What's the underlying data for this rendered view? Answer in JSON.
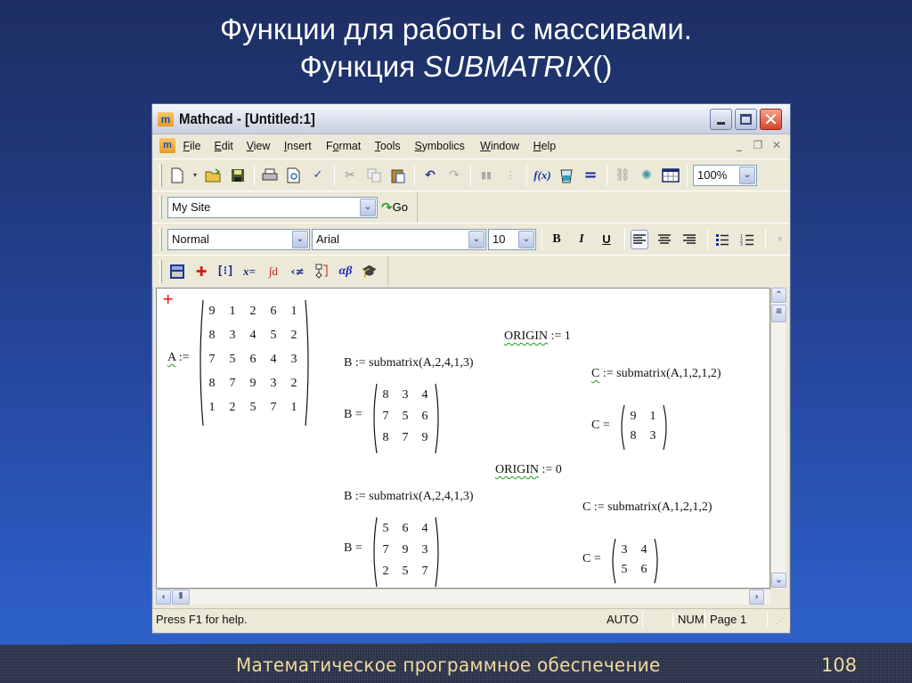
{
  "slide": {
    "title_line1": "Функции для работы с массивами.",
    "title_line2_prefix": "Функция ",
    "title_line2_func": "SUBMATRIX",
    "title_line2_suffix": "()",
    "footer_text": "Математическое программное обеспечение",
    "page_number": "108"
  },
  "window": {
    "title": "Mathcad - [Untitled:1]",
    "app_icon": "mathcad-icon",
    "controls": {
      "minimize": "minimize-icon",
      "maximize": "maximize-icon",
      "close": "close-icon"
    },
    "menu": [
      "File",
      "Edit",
      "View",
      "Insert",
      "Format",
      "Tools",
      "Symbolics",
      "Window",
      "Help"
    ],
    "menu_mnemonics": [
      "F",
      "E",
      "V",
      "I",
      "o",
      "T",
      "S",
      "W",
      "H"
    ],
    "mdi_controls": [
      "_",
      "❐",
      "✕"
    ]
  },
  "standard_toolbar": {
    "icons": [
      "new-document-icon",
      "dropdown-arrow-icon",
      "open-folder-icon",
      "save-icon",
      "print-icon",
      "print-preview-icon",
      "spellcheck-icon",
      "cut-icon",
      "copy-icon",
      "paste-icon",
      "undo-icon",
      "redo-icon",
      "align-across-icon",
      "align-down-icon",
      "insert-function-icon",
      "insert-unit-icon",
      "calculate-icon",
      "insert-hyperlink-icon",
      "component-wizard-icon",
      "resources-icon"
    ],
    "zoom_value": "100%"
  },
  "web_toolbar": {
    "address_value": "My Site",
    "go_label": "Go"
  },
  "formatting_toolbar": {
    "style_value": "Normal",
    "font_value": "Arial",
    "size_value": "10",
    "bold_label": "B",
    "italic_label": "I",
    "underline_label": "U"
  },
  "math_toolbar": {
    "icons": [
      "calculator-palette-icon",
      "graph-palette-icon",
      "matrix-palette-icon",
      "evaluation-palette-icon",
      "calculus-palette-icon",
      "boolean-palette-icon",
      "programming-palette-icon",
      "greek-palette-icon",
      "symbolic-palette-icon"
    ]
  },
  "worksheet": {
    "matrix_A": {
      "name": "A",
      "assign": ":=",
      "rows": [
        [
          9,
          1,
          2,
          6,
          1
        ],
        [
          8,
          3,
          4,
          5,
          2
        ],
        [
          7,
          5,
          6,
          4,
          3
        ],
        [
          8,
          7,
          9,
          3,
          2
        ],
        [
          1,
          2,
          5,
          7,
          1
        ]
      ]
    },
    "origin1": {
      "origin_label": "ORIGIN",
      "origin_assign": ":= 1",
      "b_def": "B := submatrix(A,2,4,1,3)",
      "b_name": "B =",
      "b_rows": [
        [
          8,
          3,
          4
        ],
        [
          7,
          5,
          6
        ],
        [
          8,
          7,
          9
        ]
      ],
      "c_def_name": "C",
      "c_def_rest": " := submatrix(A,1,2,1,2)",
      "c_name": "C =",
      "c_rows": [
        [
          9,
          1
        ],
        [
          8,
          3
        ]
      ]
    },
    "origin0": {
      "origin_label": "ORIGIN",
      "origin_assign": ":= 0",
      "b_def": "B := submatrix(A,2,4,1,3)",
      "b_name": "B =",
      "b_rows": [
        [
          5,
          6,
          4
        ],
        [
          7,
          9,
          3
        ],
        [
          2,
          5,
          7
        ]
      ],
      "c_def": "C := submatrix(A,1,2,1,2)",
      "c_name": "C =",
      "c_rows": [
        [
          3,
          4
        ],
        [
          5,
          6
        ]
      ]
    }
  },
  "statusbar": {
    "help_text": "Press F1 for help.",
    "calc_mode": "AUTO",
    "num_lock": "NUM",
    "page": "Page 1"
  }
}
